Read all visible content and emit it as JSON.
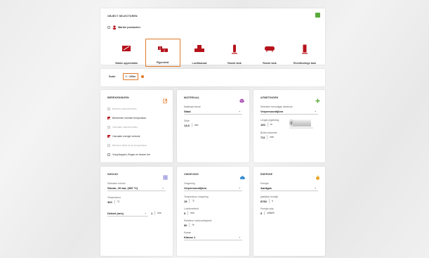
{
  "object_selectors": {
    "title": "OBJECT SELECTOREN",
    "marine_label": "Marine producten",
    "types": [
      {
        "label": "Vlakke oppervlakte",
        "active": false
      },
      {
        "label": "Pijpenleid.",
        "active": true
      },
      {
        "label": "Luchtkanaal",
        "active": false
      },
      {
        "label": "Ronde tank",
        "active": false
      },
      {
        "label": "Ronde tank",
        "active": false
      },
      {
        "label": "Rechthoekige tank",
        "active": false
      }
    ]
  },
  "scale": {
    "label": "Scale",
    "value": "1 : 100m"
  },
  "calculations": {
    "title": "BEREKENINGEN",
    "items": [
      {
        "label": "Bereken warmteverlies",
        "checked": false,
        "disabled": true
      },
      {
        "label": "Berekenen vereiste temperatuur",
        "checked": true,
        "disabled": false
      },
      {
        "label": "Calculate warmteverlies",
        "checked": false,
        "disabled": true
      },
      {
        "label": "Calculate energie verbruik",
        "checked": true,
        "disabled": false
      },
      {
        "label": "Bereken dikte tot de temperatuur",
        "checked": false,
        "disabled": true
      },
      {
        "label": "Voeg klappen, flingen en fanzen toe",
        "checked": false,
        "disabled": false
      }
    ]
  },
  "material": {
    "title": "MATERIAAL",
    "type_label": "Materiaal keuze",
    "type_value": "Staal",
    "thickness_label": "Dikte",
    "thickness_value": "13,5",
    "thickness_unit": "mm"
  },
  "dimensions": {
    "title": "AFMETINGEN",
    "dim_label": "Selecteer benodigde dimensie",
    "dim_value": "Verpersoonlijken",
    "length_label": "Lengte pijpleiding",
    "length_value": "100",
    "length_unit": "m",
    "outer_label": "Buiten diameter",
    "outer_value": "711",
    "outer_unit": "mm"
  },
  "content": {
    "title": "INHOUD",
    "select_label": "Selecteer inhoud",
    "select_value": "Stoom, 20 bar, (300 °C)",
    "temp_label": "Temperatuur",
    "temp_value": "300",
    "temp_unit": "°C",
    "flow_label": "Debiet (m/s)",
    "flow_value": "1",
    "flow_unit": "m/s"
  },
  "environment": {
    "title": "OMGEVING",
    "env_label": "Omgeving",
    "env_value": "Verpersoonlijken",
    "temp_label": "Temperatuur omgeving",
    "temp_value": "15",
    "temp_unit": "°C",
    "wind_label": "Luchtsnelheid",
    "wind_value": "5",
    "wind_unit": "m/s",
    "humidity_label": "Relatieve luchtvochtigheid",
    "humidity_value": "50",
    "humidity_unit": "%",
    "class_label": "Klasse",
    "class_value": "Klasse 1"
  },
  "energy": {
    "title": "ENERGIE",
    "energy_label": "Energie",
    "energy_value": "Aardgas",
    "hours_label": "jaarlijkse bruktijd",
    "hours_value": "8760",
    "hours_unit": "h",
    "price_label": "Energie prijs",
    "price_value": "5",
    "price_unit": "ct/kWh"
  },
  "colors": {
    "brand_red": "#b5121b",
    "accent_orange": "#e07a2a",
    "plus_green": "#5aaa3c"
  }
}
